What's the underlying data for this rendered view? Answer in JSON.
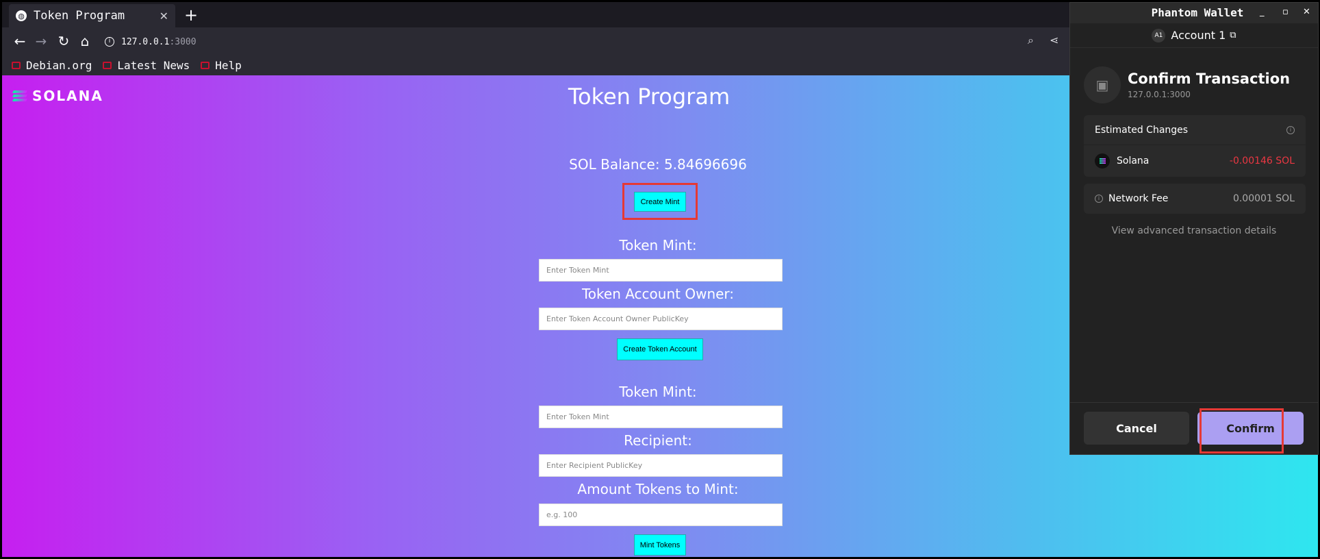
{
  "browser": {
    "tab_title": "Token Program",
    "new_tab": "+",
    "close_tab": "✕",
    "url_host": "127.0.0.1",
    "url_port": ":3000",
    "bookmarks": [
      "Debian.org",
      "Latest News",
      "Help"
    ]
  },
  "page": {
    "logo": "SOLANA",
    "title": "Token Program",
    "balance": "SOL Balance: 5.84696696",
    "create_mint": "Create Mint",
    "token_mint_label": "Token Mint:",
    "token_mint_placeholder": "Enter Token Mint",
    "owner_label": "Token Account Owner:",
    "owner_placeholder": "Enter Token Account Owner PublicKey",
    "create_token_account": "Create Token Account",
    "token_mint_label_2": "Token Mint:",
    "token_mint_placeholder_2": "Enter Token Mint",
    "recipient_label": "Recipient:",
    "recipient_placeholder": "Enter Recipient PublicKey",
    "amount_label": "Amount Tokens to Mint:",
    "amount_placeholder": "e.g. 100",
    "mint_tokens": "Mint Tokens"
  },
  "wallet": {
    "window_title": "Phantom Wallet",
    "account_badge": "A1",
    "account_name": "Account 1",
    "heading": "Confirm Transaction",
    "origin": "127.0.0.1:3000",
    "estimated_changes": "Estimated Changes",
    "asset_name": "Solana",
    "asset_change": "-0.00146 SOL",
    "network_fee_label": "Network Fee",
    "network_fee_value": "0.00001 SOL",
    "advanced_link": "View advanced transaction details",
    "cancel": "Cancel",
    "confirm": "Confirm"
  }
}
